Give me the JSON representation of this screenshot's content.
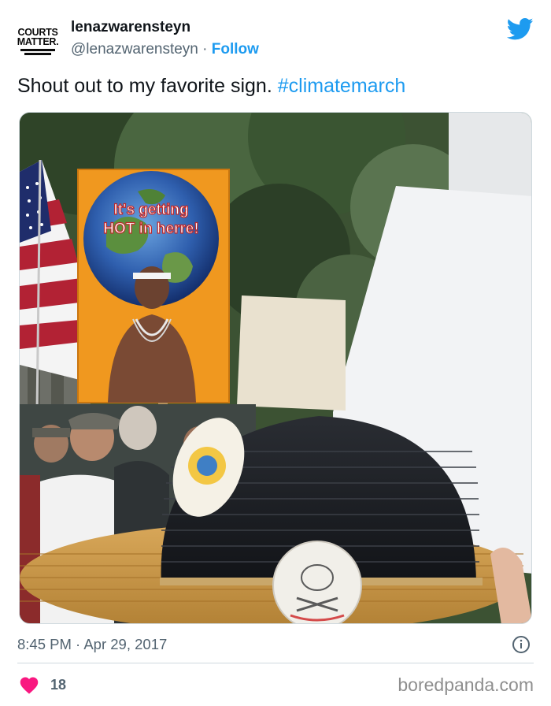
{
  "account": {
    "avatar_line1_a": "COURTS",
    "avatar_line2": "MATTER.",
    "display_name": "lenazwarensteyn",
    "handle": "@lenazwarensteyn",
    "separator": "·",
    "follow_label": "Follow"
  },
  "tweet": {
    "text": "Shout out to my favorite sign. ",
    "hashtag": "#climatemarch",
    "time": "8:45 PM",
    "date_separator": "·",
    "date": "Apr 29, 2017",
    "like_count": "18"
  },
  "photo": {
    "sign_line1": "It's getting",
    "sign_line2": "HOT in herre!"
  },
  "icons": {
    "brand": "twitter-bird-icon",
    "info": "info-icon",
    "like": "heart-icon"
  },
  "colors": {
    "link": "#1d9bf0",
    "heart": "#f91880",
    "sign_orange": "#f0981f",
    "text_secondary": "#536471"
  },
  "watermark": "boredpanda.com"
}
